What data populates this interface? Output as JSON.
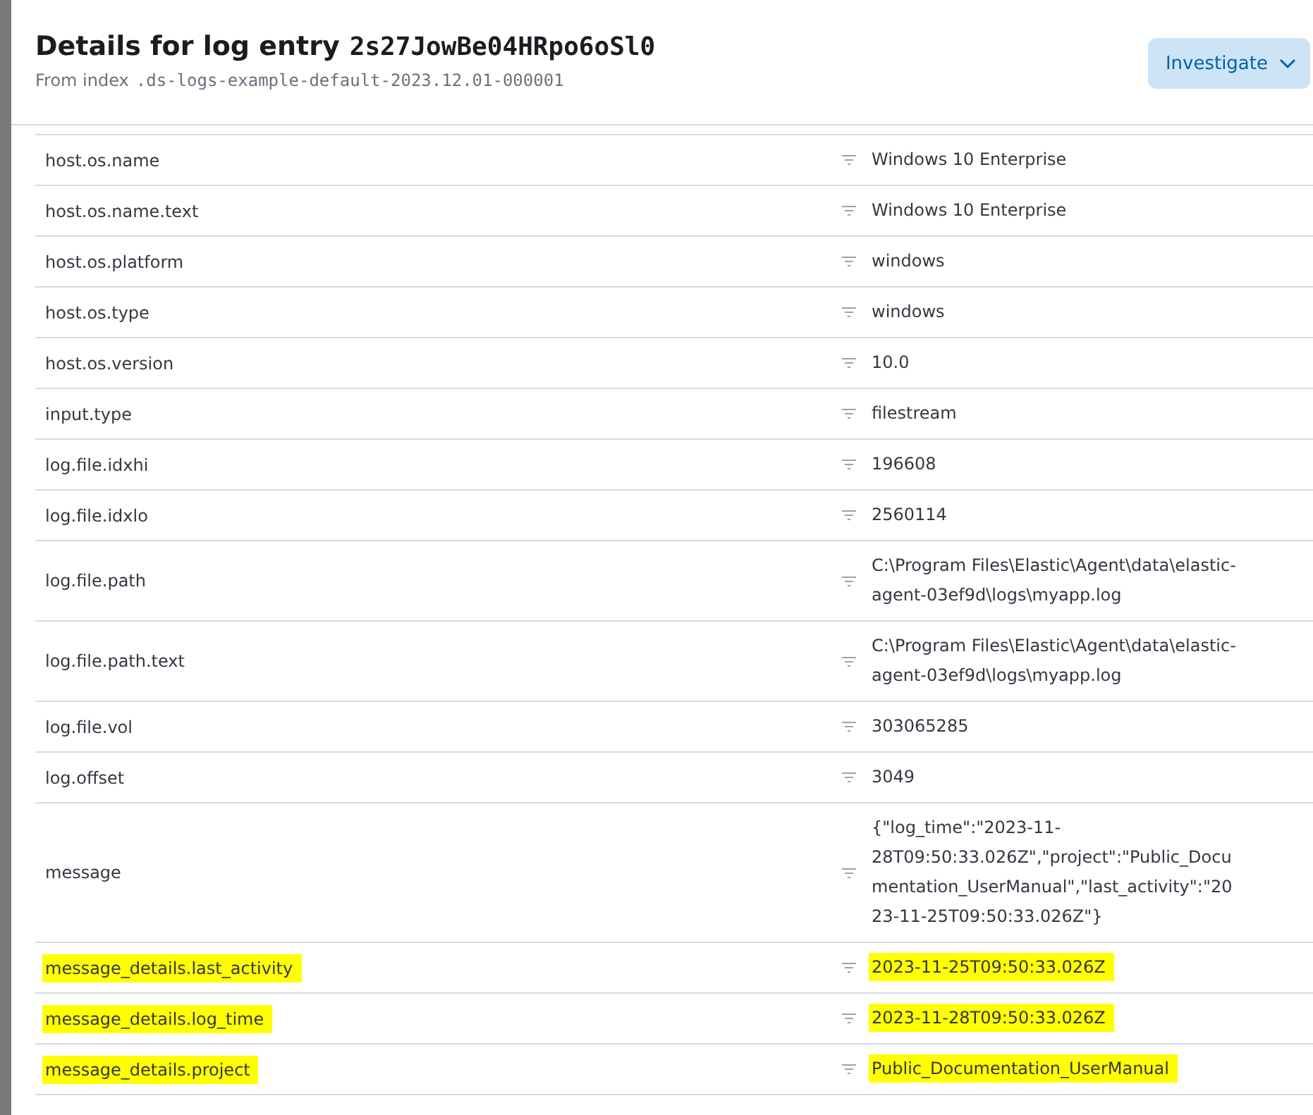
{
  "flyout": {
    "title": "Details for log entry",
    "entry_id": "2s27JowBe04HRpo6oSl0",
    "index_label": "From index",
    "index_name": ".ds-logs-example-default-2023.12.01-000001",
    "action_button": "Investigate"
  },
  "fields": [
    {
      "name": "host.os.name",
      "value": "Windows 10 Enterprise",
      "highlighted": false
    },
    {
      "name": "host.os.name.text",
      "value": "Windows 10 Enterprise",
      "highlighted": false
    },
    {
      "name": "host.os.platform",
      "value": "windows",
      "highlighted": false
    },
    {
      "name": "host.os.type",
      "value": "windows",
      "highlighted": false
    },
    {
      "name": "host.os.version",
      "value": "10.0",
      "highlighted": false
    },
    {
      "name": "input.type",
      "value": "filestream",
      "highlighted": false
    },
    {
      "name": "log.file.idxhi",
      "value": "196608",
      "highlighted": false
    },
    {
      "name": "log.file.idxlo",
      "value": "2560114",
      "highlighted": false
    },
    {
      "name": "log.file.path",
      "value": "C:\\Program Files\\Elastic\\Agent\\data\\elastic-agent-03ef9d\\logs\\myapp.log",
      "highlighted": false
    },
    {
      "name": "log.file.path.text",
      "value": "C:\\Program Files\\Elastic\\Agent\\data\\elastic-agent-03ef9d\\logs\\myapp.log",
      "highlighted": false
    },
    {
      "name": "log.file.vol",
      "value": "303065285",
      "highlighted": false
    },
    {
      "name": "log.offset",
      "value": "3049",
      "highlighted": false
    },
    {
      "name": "message",
      "value": "{\"log_time\":\"2023-11-28T09:50:33.026Z\",\"project\":\"Public_Documentation_UserManual\",\"last_activity\":\"2023-11-25T09:50:33.026Z\"}",
      "highlighted": false
    },
    {
      "name": "message_details.last_activity",
      "value": "2023-11-25T09:50:33.026Z",
      "highlighted": true
    },
    {
      "name": "message_details.log_time",
      "value": "2023-11-28T09:50:33.026Z",
      "highlighted": true
    },
    {
      "name": "message_details.project",
      "value": "Public_Documentation_UserManual",
      "highlighted": true
    }
  ]
}
